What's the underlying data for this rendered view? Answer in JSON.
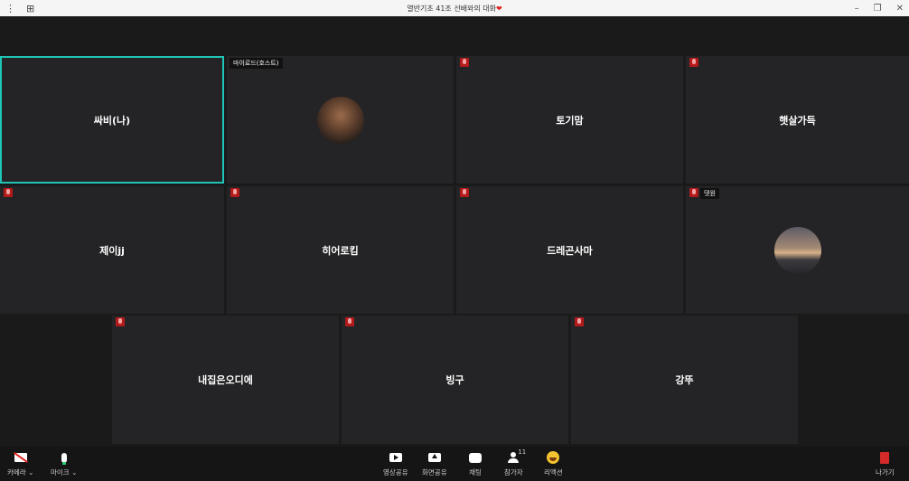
{
  "window": {
    "title": "열반기초 41조 선배와의 대화",
    "heart": "❤"
  },
  "tiles": [
    {
      "name": "싸비(나)",
      "active": true,
      "mic_muted": false
    },
    {
      "name": "",
      "tag": "마이로드(호스트)",
      "avatar": "dog"
    },
    {
      "name": "토기맘",
      "mic_muted": true
    },
    {
      "name": "햇살가득",
      "mic_muted": true
    },
    {
      "name": "제이jj",
      "mic_muted": true
    },
    {
      "name": "히어로킴",
      "mic_muted": true
    },
    {
      "name": "드레곤사마",
      "mic_muted": true
    },
    {
      "name": "",
      "tag": "댓원",
      "avatar": "sunset",
      "mic_muted": true
    },
    {
      "name": "내집은오디에",
      "mic_muted": true
    },
    {
      "name": "빙구",
      "mic_muted": true
    },
    {
      "name": "강뚜",
      "mic_muted": true
    }
  ],
  "toolbar": {
    "camera": "카메라",
    "mic": "마이크",
    "video_share": "영상공유",
    "screen_share": "화면공유",
    "chat": "채팅",
    "participants": "참가자",
    "participants_count": "11",
    "reaction": "리액션",
    "leave": "나가기"
  },
  "colors": {
    "active_border": "#1fc5b6",
    "mute_red": "#b31b1b",
    "tile_bg": "#242426"
  }
}
